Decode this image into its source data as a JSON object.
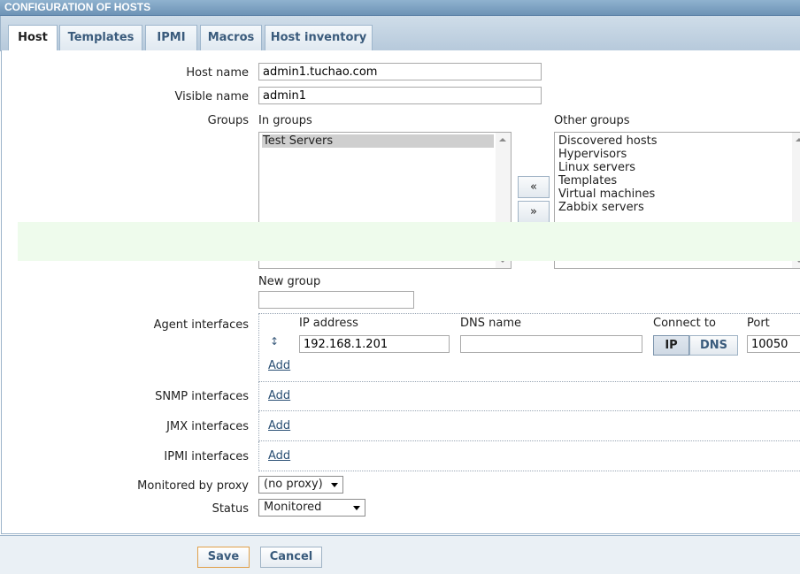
{
  "page_title": "CONFIGURATION OF HOSTS",
  "tabs": [
    {
      "label": "Host"
    },
    {
      "label": "Templates"
    },
    {
      "label": "IPMI"
    },
    {
      "label": "Macros"
    },
    {
      "label": "Host inventory"
    }
  ],
  "form": {
    "host_name_label": "Host name",
    "host_name_value": "admin1.tuchao.com",
    "visible_name_label": "Visible name",
    "visible_name_value": "admin1",
    "groups_label": "Groups",
    "in_groups_label": "In groups",
    "in_groups": [
      "Test Servers"
    ],
    "other_groups_label": "Other groups",
    "other_groups": [
      "Discovered hosts",
      "Hypervisors",
      "Linux servers",
      "Templates",
      "Virtual machines",
      "Zabbix servers"
    ],
    "move_left_label": "«",
    "move_right_label": "»",
    "new_group_label": "New group",
    "new_group_value": ""
  },
  "interfaces": {
    "agent_label": "Agent interfaces",
    "col_ip": "IP address",
    "col_dns": "DNS name",
    "col_connect": "Connect to",
    "col_port": "Port",
    "agent_ip": "192.168.1.201",
    "agent_dns": "",
    "connect_ip": "IP",
    "connect_dns": "DNS",
    "agent_port": "10050",
    "add_label": "Add",
    "snmp_label": "SNMP interfaces",
    "jmx_label": "JMX interfaces",
    "ipmi_label": "IPMI interfaces"
  },
  "proxy": {
    "label": "Monitored by proxy",
    "value": "(no proxy)"
  },
  "status": {
    "label": "Status",
    "value": "Monitored"
  },
  "actions": {
    "save": "Save",
    "cancel": "Cancel"
  }
}
